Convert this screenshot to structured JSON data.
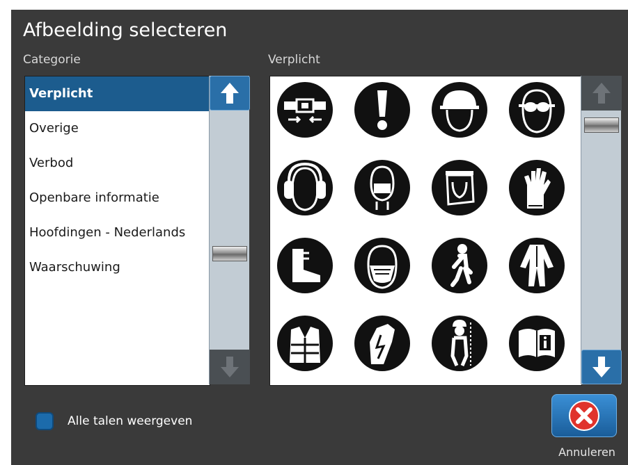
{
  "dialog": {
    "title": "Afbeelding selecteren",
    "category_header": "Categorie",
    "images_header": "Verplicht"
  },
  "categories": [
    {
      "label": "Verplicht",
      "selected": true
    },
    {
      "label": "Overige",
      "selected": false
    },
    {
      "label": "Verbod",
      "selected": false
    },
    {
      "label": "Openbare informatie",
      "selected": false
    },
    {
      "label": "Hoofdingen - Nederlands",
      "selected": false
    },
    {
      "label": "Waarschuwing",
      "selected": false
    }
  ],
  "symbols": [
    {
      "icon": "seatbelt-icon"
    },
    {
      "icon": "exclamation-icon"
    },
    {
      "icon": "hard-hat-icon"
    },
    {
      "icon": "safety-goggles-icon"
    },
    {
      "icon": "ear-protection-icon"
    },
    {
      "icon": "face-mask-icon"
    },
    {
      "icon": "face-shield-icon"
    },
    {
      "icon": "gloves-icon"
    },
    {
      "icon": "safety-boots-icon"
    },
    {
      "icon": "respirator-icon"
    },
    {
      "icon": "pedestrian-icon"
    },
    {
      "icon": "protective-clothing-icon"
    },
    {
      "icon": "safety-vest-icon"
    },
    {
      "icon": "insulating-gloves-icon"
    },
    {
      "icon": "harness-icon"
    },
    {
      "icon": "read-manual-icon"
    }
  ],
  "options": {
    "all_languages_label": "Alle talen weergeven",
    "all_languages_checked": false
  },
  "actions": {
    "cancel_label": "Annuleren"
  },
  "colors": {
    "dialog_bg": "#3a3a3a",
    "selected_bg": "#1c5c8e",
    "accent": "#2a6fa8",
    "cancel_red": "#e0332c"
  }
}
